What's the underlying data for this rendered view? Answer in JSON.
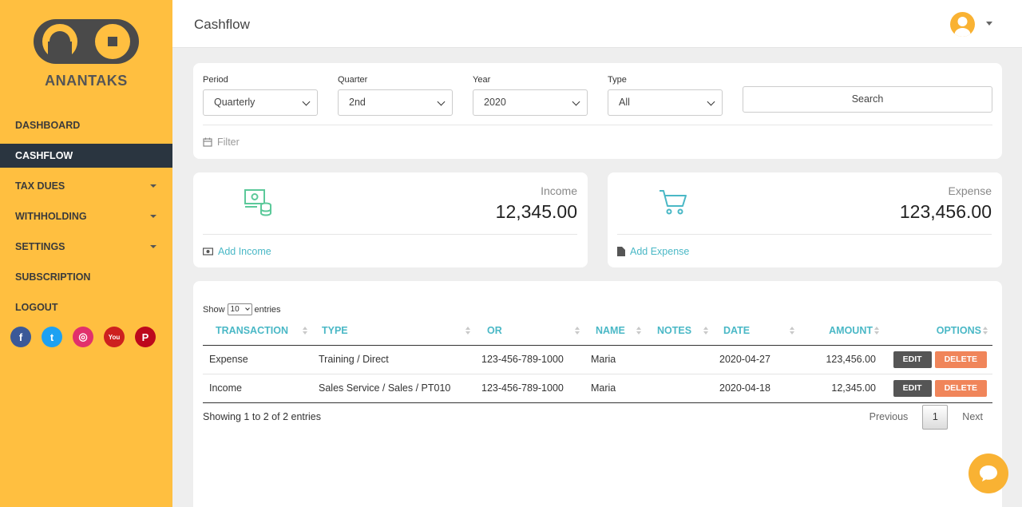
{
  "sidebar": {
    "brand": "ANANTAKS",
    "items": [
      {
        "label": "DASHBOARD",
        "active": false,
        "has_submenu": false
      },
      {
        "label": "CASHFLOW",
        "active": true,
        "has_submenu": false
      },
      {
        "label": "TAX DUES",
        "active": false,
        "has_submenu": true
      },
      {
        "label": "WITHHOLDING",
        "active": false,
        "has_submenu": true
      },
      {
        "label": "SETTINGS",
        "active": false,
        "has_submenu": true
      },
      {
        "label": "SUBSCRIPTION",
        "active": false,
        "has_submenu": false
      },
      {
        "label": "LOGOUT",
        "active": false,
        "has_submenu": false
      }
    ],
    "socials": [
      {
        "icon": "facebook-icon",
        "glyph": "f",
        "color": "#3b5998"
      },
      {
        "icon": "twitter-icon",
        "glyph": "t",
        "color": "#1da1f2"
      },
      {
        "icon": "instagram-icon",
        "glyph": "◎",
        "color": "#e1306c"
      },
      {
        "icon": "youtube-icon",
        "glyph": "You",
        "color": "#cd201f"
      },
      {
        "icon": "pinterest-icon",
        "glyph": "P",
        "color": "#bd081c"
      }
    ]
  },
  "header": {
    "title": "Cashflow"
  },
  "filters": {
    "period": {
      "label": "Period",
      "value": "Quarterly"
    },
    "quarter": {
      "label": "Quarter",
      "value": "2nd"
    },
    "year": {
      "label": "Year",
      "value": "2020"
    },
    "type": {
      "label": "Type",
      "value": "All"
    },
    "search_label": "Search",
    "filter_label": "Filter"
  },
  "income": {
    "label": "Income",
    "value": "12,345.00",
    "link": "Add Income"
  },
  "expense": {
    "label": "Expense",
    "value": "123,456.00",
    "link": "Add Expense"
  },
  "table": {
    "show_label": "Show",
    "entries_value": "10",
    "entries_label": "entries",
    "columns": [
      "TRANSACTION",
      "TYPE",
      "OR",
      "NAME",
      "NOTES",
      "DATE",
      "AMOUNT",
      "OPTIONS"
    ],
    "rows": [
      {
        "transaction": "Expense",
        "type": "Training / Direct",
        "or": "123-456-789-1000",
        "name": "Maria",
        "notes": "",
        "date": "2020-04-27",
        "amount": "123,456.00"
      },
      {
        "transaction": "Income",
        "type": "Sales Service / Sales / PT010",
        "or": "123-456-789-1000",
        "name": "Maria",
        "notes": "",
        "date": "2020-04-18",
        "amount": "12,345.00"
      }
    ],
    "edit_label": "EDIT",
    "delete_label": "DELETE",
    "info": "Showing 1 to 2 of 2 entries",
    "pager": {
      "previous": "Previous",
      "page": "1",
      "next": "Next"
    }
  },
  "colors": {
    "sidebar": "#ffbf40",
    "active_nav": "#2a3540",
    "accent": "#4ab8c6",
    "income_icon": "#5cc99a",
    "delete": "#f0855a"
  }
}
